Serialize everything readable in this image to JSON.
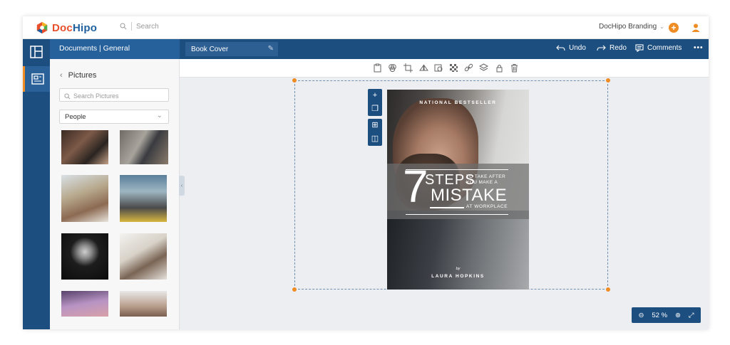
{
  "app": {
    "logo_prefix": "Doc",
    "logo_suffix": "Hipo"
  },
  "topbar": {
    "search_placeholder": "Search",
    "branding_label": "DocHipo Branding"
  },
  "subheader": {
    "doc_path": "Documents | General",
    "doc_name": "Book Cover",
    "undo_label": "Undo",
    "redo_label": "Redo",
    "comments_label": "Comments",
    "more_label": "•••"
  },
  "panel": {
    "title": "Pictures",
    "search_placeholder": "Search Pictures",
    "category_selected": "People"
  },
  "cover": {
    "top_label": "NATIONAL BESTSELLER",
    "number": "7",
    "steps": "STEPS",
    "small_line1": "TO TAKE AFTER",
    "small_line2": "YOU MAKE A",
    "mistake": "MISTAKE",
    "workplace": "AT WORKPLACE",
    "by": "by",
    "author": "LAURA HOPKINS"
  },
  "zoom": {
    "value": "52",
    "unit": "%"
  },
  "colors": {
    "primary": "#1c4e7f",
    "accent": "#f08c24",
    "brand_red": "#e8502b"
  }
}
